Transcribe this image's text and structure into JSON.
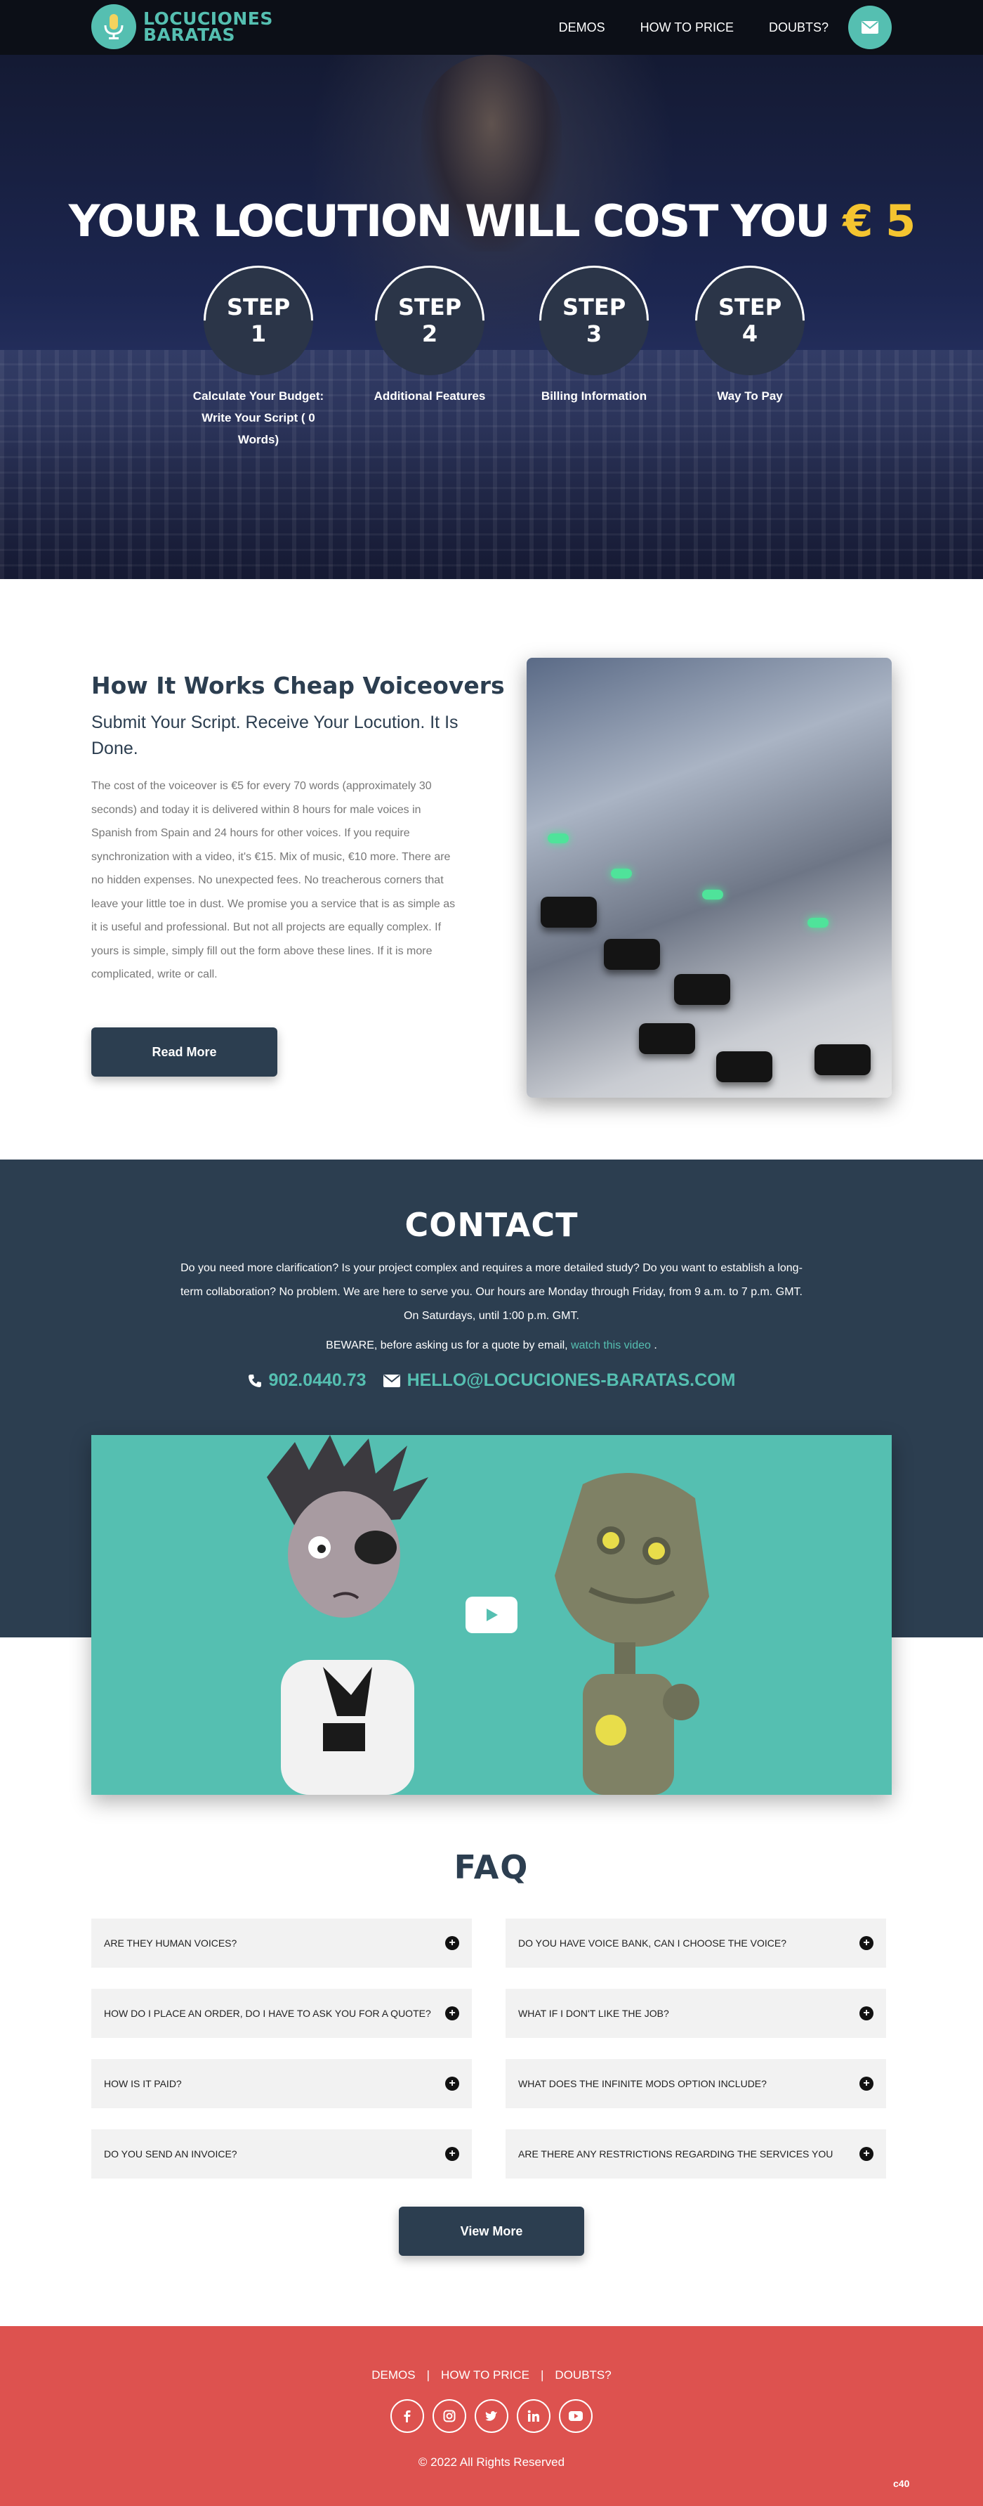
{
  "brand": {
    "line1": "LOCUCIONES",
    "line2": "BARATAS"
  },
  "nav": {
    "items": [
      "DEMOS",
      "HOW TO PRICE",
      "DOUBTS?"
    ]
  },
  "hero": {
    "title": "YOUR LOCUTION WILL COST YOU",
    "price": "€ 5",
    "steps": [
      {
        "word": "STEP",
        "num": "1",
        "label": "Calculate Your Budget: Write Your Script ( 0 Words)"
      },
      {
        "word": "STEP",
        "num": "2",
        "label": "Additional Features"
      },
      {
        "word": "STEP",
        "num": "3",
        "label": "Billing Information"
      },
      {
        "word": "STEP",
        "num": "4",
        "label": "Way To Pay"
      }
    ]
  },
  "how": {
    "title": "How It Works Cheap Voiceovers",
    "subtitle": "Submit Your Script. Receive Your Locution. It Is Done.",
    "body": "The cost of the voiceover is €5 for every 70 words (approximately 30 seconds) and today it is delivered within 8 hours for male voices in Spanish from Spain and 24 hours for other voices. If you require synchronization with a video, it's €15. Mix of music, €10 more. There are no hidden expenses. No unexpected fees. No treacherous corners that leave your little toe in dust. We promise you a service that is as simple as it is useful and professional. But not all projects are equally complex. If yours is simple, simply fill out the form above these lines. If it is more complicated, write or call.",
    "button": "Read More"
  },
  "contact": {
    "title": "CONTACT",
    "text": "Do you need more clarification? Is your project complex and requires a more detailed study? Do you want to establish a long-term collaboration? No problem. We are here to serve you. Our hours are Monday through Friday, from 9 a.m. to 7 p.m. GMT. On Saturdays, until 1:00 p.m. GMT.",
    "beware_prefix": "BEWARE, before asking us for a quote by email,",
    "beware_link": "watch this video",
    "beware_suffix": ".",
    "phone": "902.0440.73",
    "email": "HELLO@LOCUCIONES-BARATAS.COM"
  },
  "faq": {
    "title": "FAQ",
    "items": [
      "ARE THEY HUMAN VOICES?",
      "DO YOU HAVE VOICE BANK, CAN I CHOOSE THE VOICE?",
      "HOW DO I PLACE AN ORDER, DO I HAVE TO ASK YOU FOR A QUOTE?",
      "WHAT IF I DON'T LIKE THE JOB?",
      "HOW IS IT PAID?",
      "WHAT DOES THE INFINITE MODS OPTION INCLUDE?",
      "DO YOU SEND AN INVOICE?",
      "ARE THERE ANY RESTRICTIONS REGARDING THE SERVICES YOU"
    ],
    "button": "View More"
  },
  "footer": {
    "links": [
      "DEMOS",
      "HOW TO PRICE",
      "DOUBTS?"
    ],
    "separator": "|",
    "socials": [
      "facebook-icon",
      "instagram-icon",
      "twitter-icon",
      "linkedin-icon",
      "youtube-icon"
    ],
    "copyright": "© 2022 All Rights Reserved",
    "badge": "c40"
  },
  "colors": {
    "accent": "#55bfb1",
    "navy": "#2c3e50",
    "price": "#f4c430",
    "footer": "#dd524f"
  }
}
